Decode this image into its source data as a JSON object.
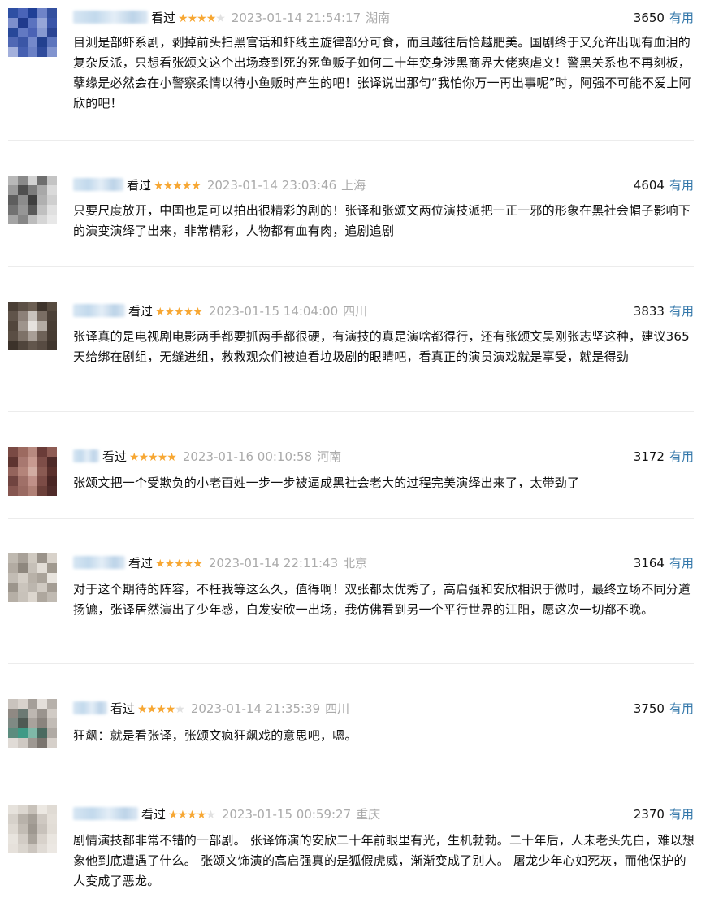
{
  "reviews": [
    {
      "status": "看过",
      "stars": 4,
      "date": "2023-01-14 21:54:17",
      "location": "湖南",
      "votes": "3650",
      "useful_label": "有用",
      "text": "目测是部虾系剧，剥掉前头扫黑官话和虾线主旋律部分可食，而且越往后恰越肥美。国剧终于又允许出现有血泪的复杂反派，只想看张颂文这个出场衰到死的死鱼贩子如何二十年变身涉黑商界大佬爽虐文！警黑关系也不再刻板，孽缘是必然会在小警察柔情以待小鱼贩时产生的吧！张译说出那句“我怕你万一再出事呢”时，阿强不可能不爱上阿欣的吧！",
      "avatar_colors": [
        "#2e4fa3",
        "#4a64b8",
        "#1f3f96",
        "#6f84c8",
        "#34509f",
        "#7d8fcc",
        "#203a8c",
        "#5b73bf",
        "#96a6d8",
        "#3a55a8",
        "#284899",
        "#6279c2",
        "#4b63b5",
        "#8699d1",
        "#2a4493",
        "#5068b4",
        "#3b56a6",
        "#7489cb",
        "#22408f",
        "#5d75bd",
        "#a3b0dc",
        "#4660b1",
        "#6a80c5",
        "#2f4b9c",
        "#8194cf"
      ]
    },
    {
      "status": "看过",
      "stars": 5,
      "date": "2023-01-14 23:03:46",
      "location": "上海",
      "votes": "4604",
      "useful_label": "有用",
      "text": "只要尺度放开，中国也是可以拍出很精彩的剧的！张译和张颂文两位演技派把一正一邪的形象在黑社会帽子影响下的演变演绎了出来，非常精彩，人物都有血有肉，追剧追剧",
      "avatar_colors": [
        "#b8b8b8",
        "#8a8a8a",
        "#d2d2d2",
        "#6e6e6e",
        "#c4c4c4",
        "#9a9a9a",
        "#4f4f4f",
        "#7c7c7c",
        "#a8a8a8",
        "#dadada",
        "#5e5e5e",
        "#8c8c8c",
        "#3f3f3f",
        "#b0b0b0",
        "#cfcfcf",
        "#727272",
        "#969696",
        "#5a5a5a",
        "#c0c0c0",
        "#e0e0e0",
        "#a4a4a4",
        "#868686",
        "#bcbcbc",
        "#d6d6d6",
        "#e8e8e8"
      ]
    },
    {
      "status": "看过",
      "stars": 5,
      "date": "2023-01-15 14:04:00",
      "location": "四川",
      "votes": "3833",
      "useful_label": "有用",
      "text": "张译真的是电视剧电影两手都要抓两手都很硬，有演技的真是演啥都得行，还有张颂文吴刚张志坚这种，建议365天给绑在剧组，无缝进组，救救观众们被迫看垃圾剧的眼睛吧，看真正的演员演戏就是享受，就是得劲",
      "avatar_colors": [
        "#4a3f36",
        "#5c5046",
        "#6b5e52",
        "#3e342c",
        "#574b40",
        "#60544a",
        "#8c8078",
        "#c8c2bc",
        "#7a6e64",
        "#4c4138",
        "#52463c",
        "#9e948c",
        "#e6e2de",
        "#b4aca4",
        "#483d34",
        "#5a4e44",
        "#7e7268",
        "#a89e96",
        "#6e6258",
        "#463b32",
        "#3c322a",
        "#50453c",
        "#62564c",
        "#574b42",
        "#40362e"
      ]
    },
    {
      "status": "看过",
      "stars": 5,
      "date": "2023-01-16 00:10:58",
      "location": "河南",
      "votes": "3172",
      "useful_label": "有用",
      "text": "张颂文把一个受欺负的小老百姓一步一步被逼成黑社会老大的过程完美演绎出来了，太带劲了",
      "avatar_colors": [
        "#7a4a44",
        "#9c6a60",
        "#b88a80",
        "#6a3c38",
        "#8e5c54",
        "#5e3430",
        "#a87870",
        "#c89a90",
        "#7e4e48",
        "#4e2a28",
        "#94645c",
        "#b4847a",
        "#d2aca2",
        "#8a5a52",
        "#5a302c",
        "#704440",
        "#a07068",
        "#c09088",
        "#7c4c46",
        "#4a2624",
        "#865650",
        "#9a6a62",
        "#b08076",
        "#6c403a",
        "#502c2a"
      ]
    },
    {
      "status": "看过",
      "stars": 5,
      "date": "2023-01-14 22:11:43",
      "location": "北京",
      "votes": "3164",
      "useful_label": "有用",
      "text": "对于这个期待的阵容，不枉我等这么久，值得啊！双张都太优秀了，高启强和安欣相识于微时，最终立场不同分道扬镳，张译居然演出了少年感，白发安欣一出场，我仿佛看到另一个平行世界的江阳，愿这次一切都不晚。",
      "avatar_colors": [
        "#bfb9b0",
        "#a8a198",
        "#cfc9c0",
        "#9a938a",
        "#d8d2ca",
        "#b2aba2",
        "#8e877e",
        "#c6c0b8",
        "#e2ddd6",
        "#a0998f",
        "#c2bcb4",
        "#d4cec6",
        "#b8b1a8",
        "#aaa39a",
        "#e8e4de",
        "#9c958c",
        "#cac4bc",
        "#bcb6ae",
        "#d0cac2",
        "#a49d94",
        "#b6afa6",
        "#c8c2ba",
        "#dcd6ce",
        "#aea79e",
        "#c0bab2"
      ]
    },
    {
      "status": "看过",
      "stars": 4,
      "date": "2023-01-14 21:35:39",
      "location": "四川",
      "votes": "3750",
      "useful_label": "有用",
      "text": "狂飙：就是看张译，张颂文疯狂飙戏的意思吧，嗯。",
      "avatar_colors": [
        "#c9c3bd",
        "#d8d2cc",
        "#a59f99",
        "#e4dfda",
        "#b7b1ab",
        "#8f8983",
        "#6c7a74",
        "#bdb7b1",
        "#9a948e",
        "#d1cbc5",
        "#7f8a84",
        "#4f5a54",
        "#a8a29c",
        "#8a847e",
        "#c2bcb6",
        "#5c8c7e",
        "#3f9a86",
        "#7fb8a8",
        "#4a6a60",
        "#b0aaa4",
        "#e0dbd6",
        "#cfc9c3",
        "#9e9892",
        "#7a746e",
        "#d6d0ca"
      ]
    },
    {
      "status": "看过",
      "stars": 4,
      "date": "2023-01-15 00:59:27",
      "location": "重庆",
      "votes": "2370",
      "useful_label": "有用",
      "text": "剧情演技都非常不错的一部剧。 张译饰演的安欣二十年前眼里有光，生机勃勃。二十年后，人未老头先白，难以想象他到底遭遇了什么。 张颂文饰演的高启强真的是狐假虎威，渐渐变成了别人。 屠龙少年心如死灰，而他保护的人变成了恶龙。",
      "avatar_colors": [
        "#e6e2dc",
        "#dcd7d0",
        "#c8c2ba",
        "#ece8e2",
        "#e0dbd4",
        "#d6d1ca",
        "#b8b2aa",
        "#a6a098",
        "#cfc9c2",
        "#e4dfd8",
        "#ded9d2",
        "#c2bcb4",
        "#9e9890",
        "#c8c2bb",
        "#e2ddd6",
        "#e8e4de",
        "#d2ccc5",
        "#aaa49c",
        "#d8d2cb",
        "#eae6e0",
        "#e6e1db",
        "#dad5ce",
        "#ccc6bf",
        "#e0dbd5",
        "#ece8e3"
      ]
    }
  ],
  "colors": {
    "star_on": "#f7a733",
    "star_off": "#e1e1e1",
    "link": "#3377aa",
    "meta": "#aaaaaa",
    "divider": "#ececec"
  }
}
